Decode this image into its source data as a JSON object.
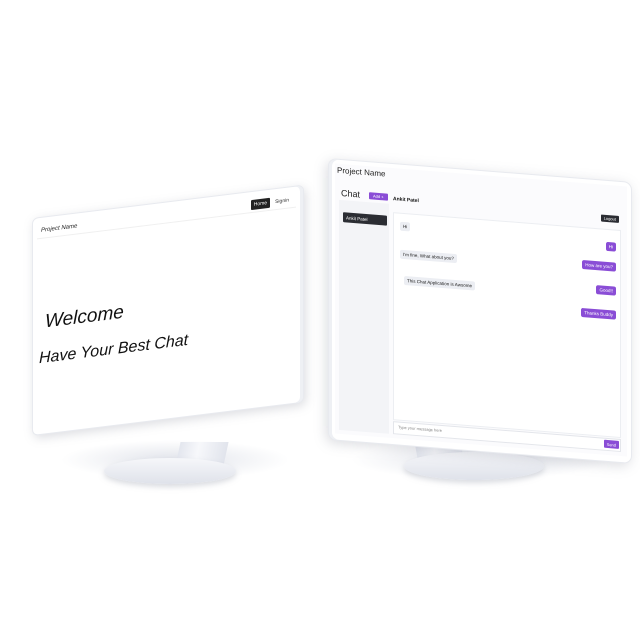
{
  "left_app": {
    "brand": "Project Name",
    "nav": {
      "home": "Home",
      "signin": "Signin"
    },
    "welcome": "Welcome",
    "tagline": "Have Your Best Chat"
  },
  "right_app": {
    "project_title": "Project Name",
    "chat_heading": "Chat",
    "add_label": "Add +",
    "contacts": [
      {
        "name": "Ankit Patel"
      }
    ],
    "active_chat": {
      "name": "Ankit Patel"
    },
    "logout_label": "Logout",
    "messages": [
      {
        "side": "in",
        "text": "Hi"
      },
      {
        "side": "out",
        "text": "Hi"
      },
      {
        "side": "out",
        "text": "How are you?"
      },
      {
        "side": "in",
        "text": "I'm fine, What about you?"
      },
      {
        "side": "out",
        "text": "Good!!"
      },
      {
        "side": "in",
        "text": "This Chat Application is Awsome"
      },
      {
        "side": "out",
        "text": "Thanks Buddy"
      }
    ],
    "composer": {
      "placeholder": "Type your message here",
      "send_label": "Send"
    },
    "accent_color": "#8a4dd6"
  }
}
